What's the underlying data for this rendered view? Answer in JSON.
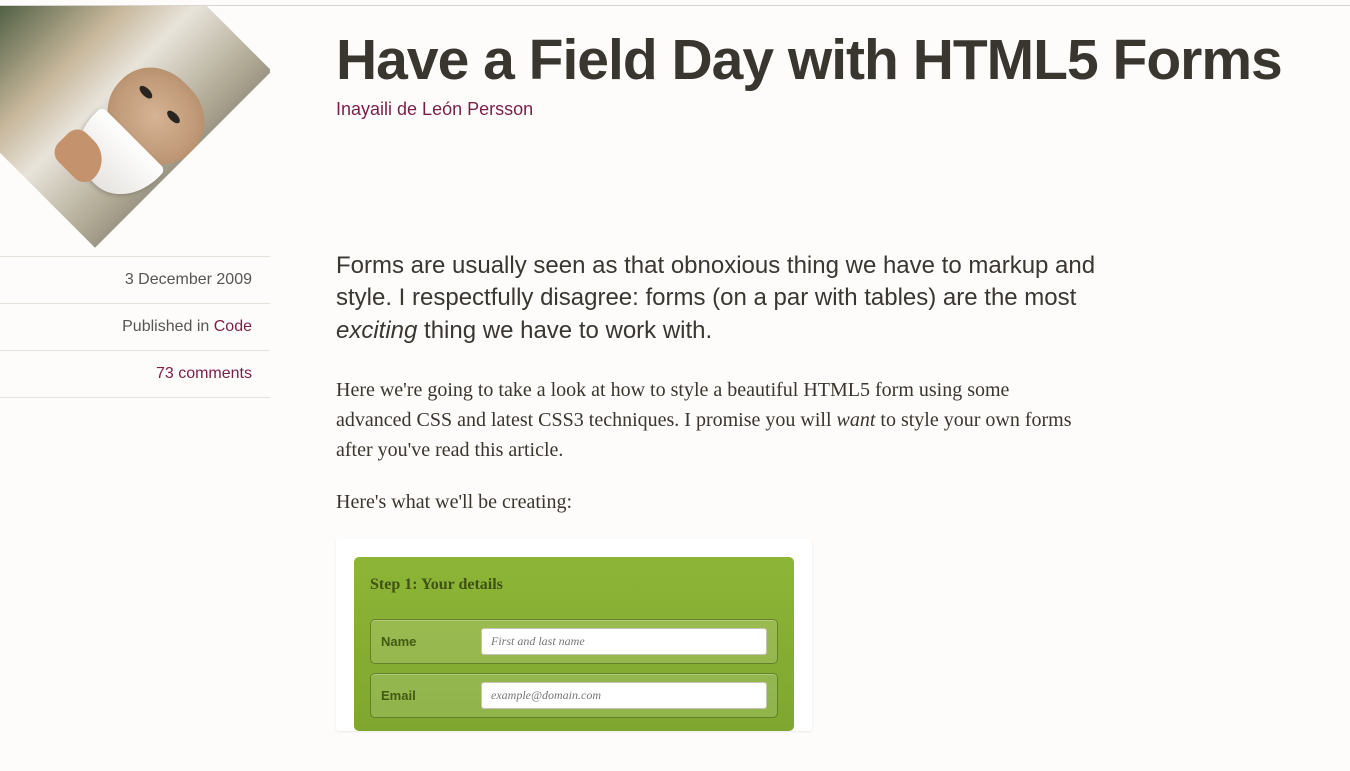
{
  "article": {
    "title": "Have a Field Day with HTML5 Forms",
    "author": "Inayaili de León Persson",
    "lede_html": "Forms are usually seen as that obnoxious thing we have to markup and style. I respectfully disagree: forms (on a par with tables) are the most <em>exciting</em> thing we have to work with.",
    "body": [
      "Here we're going to take a look at how to style a beautiful HTML5 form using some advanced CSS and latest CSS3 techniques. I promise you will <em>want</em> to style your own forms after you've read this article.",
      "Here's what we'll be creating:"
    ]
  },
  "meta": {
    "date": "3 December 2009",
    "published_prefix": "Published in ",
    "category": "Code",
    "comments": "73 comments"
  },
  "form": {
    "legend": "Step 1: Your details",
    "rows": [
      {
        "label": "Name",
        "placeholder": "First and last name"
      },
      {
        "label": "Email",
        "placeholder": "example@domain.com"
      }
    ]
  }
}
